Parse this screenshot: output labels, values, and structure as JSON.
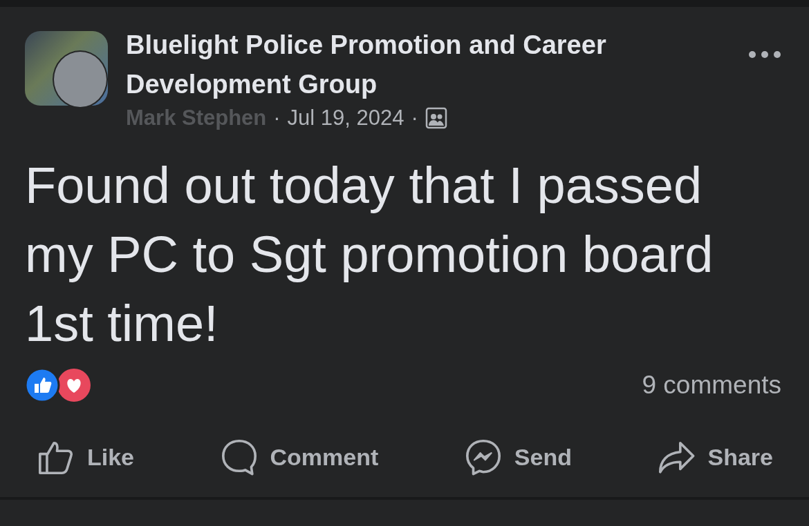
{
  "post": {
    "group_name": "Bluelight Police Promotion and Career Development Group",
    "author": "Mark Stephen",
    "date": "Jul 19, 2024",
    "separator": "·",
    "text": "Found out today that I passed my PC to Sgt promotion board 1st time!",
    "comment_count": "9 comments"
  },
  "actions": [
    {
      "kind": "like",
      "label": "Like"
    },
    {
      "kind": "comment",
      "label": "Comment"
    },
    {
      "kind": "send",
      "label": "Send"
    },
    {
      "kind": "share",
      "label": "Share"
    }
  ]
}
